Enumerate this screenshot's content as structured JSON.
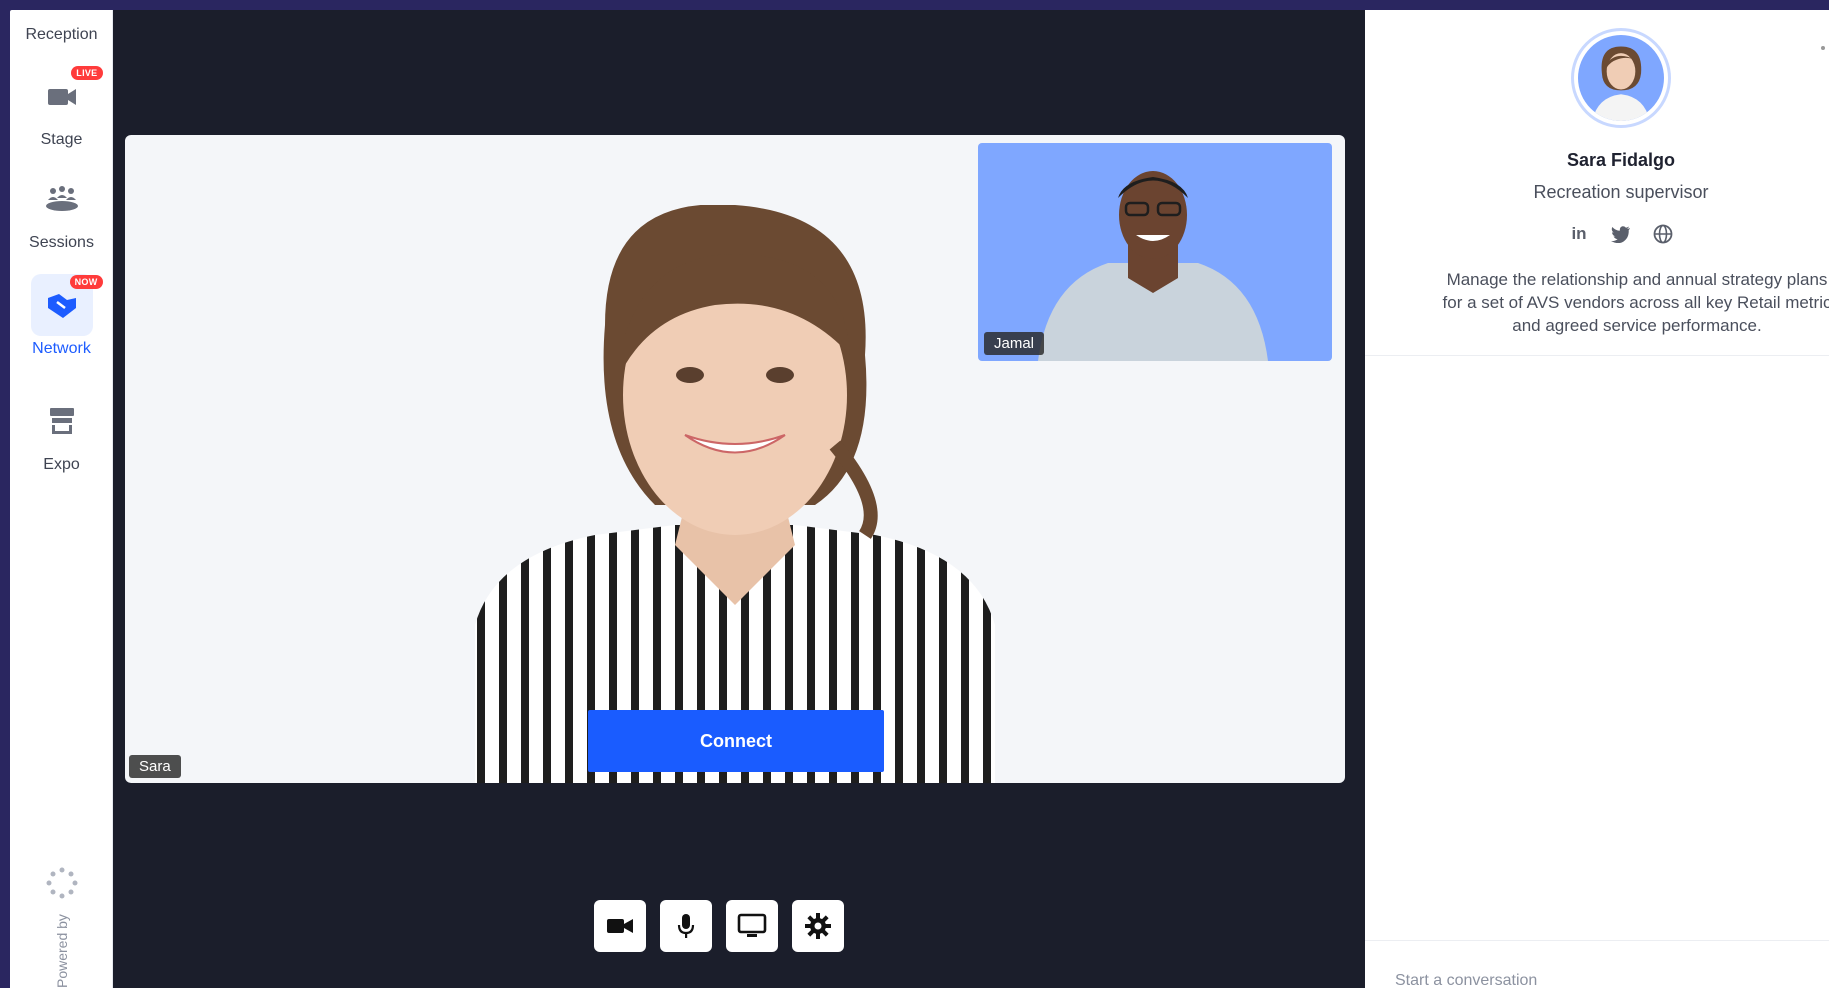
{
  "sidebar": {
    "reception_label": "Reception",
    "items": [
      {
        "label": "Stage",
        "icon": "camera-icon",
        "badge": "LIVE"
      },
      {
        "label": "Sessions",
        "icon": "people-icon",
        "badge": ""
      },
      {
        "label": "Network",
        "icon": "handshake-icon",
        "badge": "NOW",
        "active": true
      },
      {
        "label": "Expo",
        "icon": "booth-icon",
        "badge": ""
      }
    ],
    "powered_by": "Powered by"
  },
  "stage": {
    "main_participant": "Sara",
    "pip_participant": "Jamal",
    "connect_label": "Connect",
    "controls": [
      "camera-icon",
      "microphone-icon",
      "screen-share-icon",
      "settings-icon"
    ]
  },
  "profile": {
    "name": "Sara Fidalgo",
    "title": "Recreation supervisor",
    "socials": [
      "linkedin-icon",
      "twitter-icon",
      "globe-icon"
    ],
    "linkedin_label": "in",
    "bio_lines": [
      "Manage the relationship and annual strategy plans",
      "for a set of AVS vendors across all key Retail metric",
      "and agreed service performance."
    ],
    "chat_placeholder": "Start a conversation"
  },
  "colors": {
    "accent": "#1a5cff",
    "live_badge": "#ff3b3b",
    "stage_bg": "#1b1e2b",
    "frame_border": "#2a2660",
    "pip_bg": "#7fa7ff"
  }
}
